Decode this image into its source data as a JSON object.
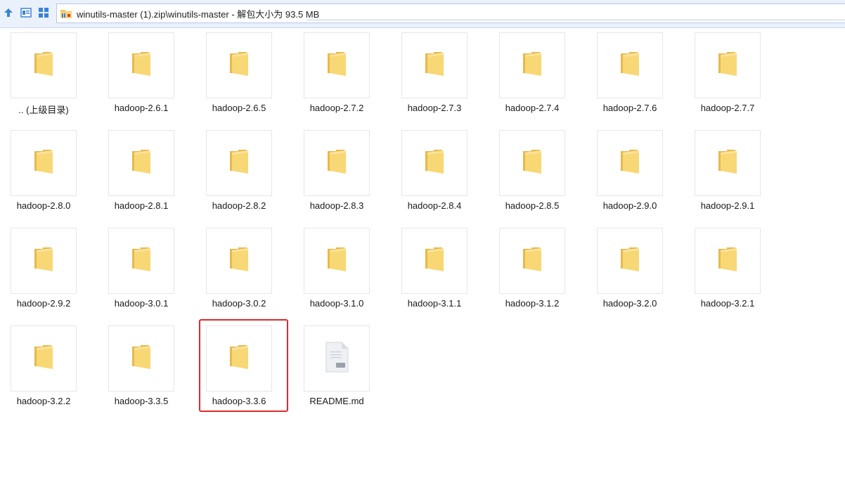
{
  "toolbar": {
    "up_icon": "arrow-up-icon",
    "view_icon": "window-view-icon",
    "grid_icon": "grid-view-icon"
  },
  "address": {
    "icon": "zip-folder-icon",
    "path": "winutils-master (1).zip\\winutils-master - 解包大小为 93.5 MB"
  },
  "items": [
    {
      "label": ".. (上级目录)",
      "type": "folder"
    },
    {
      "label": "hadoop-2.6.1",
      "type": "folder"
    },
    {
      "label": "hadoop-2.6.5",
      "type": "folder"
    },
    {
      "label": "hadoop-2.7.2",
      "type": "folder"
    },
    {
      "label": "hadoop-2.7.3",
      "type": "folder"
    },
    {
      "label": "hadoop-2.7.4",
      "type": "folder"
    },
    {
      "label": "hadoop-2.7.6",
      "type": "folder"
    },
    {
      "label": "hadoop-2.7.7",
      "type": "folder"
    },
    {
      "label": "hadoop-2.8.0",
      "type": "folder"
    },
    {
      "label": "hadoop-2.8.1",
      "type": "folder"
    },
    {
      "label": "hadoop-2.8.2",
      "type": "folder"
    },
    {
      "label": "hadoop-2.8.3",
      "type": "folder"
    },
    {
      "label": "hadoop-2.8.4",
      "type": "folder"
    },
    {
      "label": "hadoop-2.8.5",
      "type": "folder"
    },
    {
      "label": "hadoop-2.9.0",
      "type": "folder"
    },
    {
      "label": "hadoop-2.9.1",
      "type": "folder"
    },
    {
      "label": "hadoop-2.9.2",
      "type": "folder"
    },
    {
      "label": "hadoop-3.0.1",
      "type": "folder"
    },
    {
      "label": "hadoop-3.0.2",
      "type": "folder"
    },
    {
      "label": "hadoop-3.1.0",
      "type": "folder"
    },
    {
      "label": "hadoop-3.1.1",
      "type": "folder"
    },
    {
      "label": "hadoop-3.1.2",
      "type": "folder"
    },
    {
      "label": "hadoop-3.2.0",
      "type": "folder"
    },
    {
      "label": "hadoop-3.2.1",
      "type": "folder"
    },
    {
      "label": "hadoop-3.2.2",
      "type": "folder"
    },
    {
      "label": "hadoop-3.3.5",
      "type": "folder"
    },
    {
      "label": "hadoop-3.3.6",
      "type": "folder",
      "highlighted": true
    },
    {
      "label": "README.md",
      "type": "file"
    }
  ],
  "colors": {
    "folder": "#f8d775",
    "folder_dark": "#e8b94a",
    "highlight": "#e0282c",
    "accent": "#2f7bd8"
  }
}
